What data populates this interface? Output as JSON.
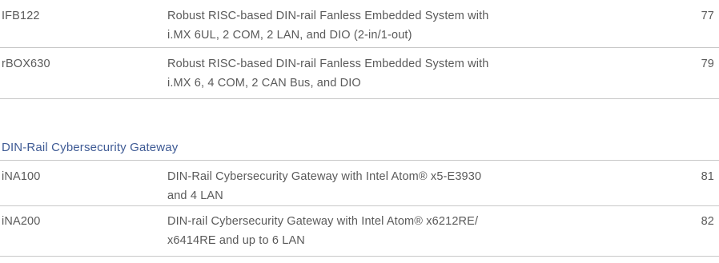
{
  "groups": [
    {
      "rows": [
        {
          "model": "IFB122",
          "desc_line1": "Robust RISC-based DIN-rail Fanless Embedded System with",
          "desc_line2": "i.MX 6UL, 2 COM, 2 LAN, and DIO (2-in/1-out)",
          "page": "77"
        },
        {
          "model": "rBOX630",
          "desc_line1": "Robust RISC-based DIN-rail Fanless Embedded System with",
          "desc_line2": "i.MX 6, 4 COM, 2 CAN Bus, and DIO",
          "page": "79"
        }
      ]
    },
    {
      "title": "DIN-Rail Cybersecurity Gateway",
      "rows": [
        {
          "model": "iNA100",
          "desc_line1": "DIN-Rail Cybersecurity Gateway with Intel Atom® x5-E3930",
          "desc_line2": "and 4 LAN",
          "page": "81"
        },
        {
          "model": "iNA200",
          "desc_line1": "DIN-rail Cybersecurity Gateway with Intel Atom® x6212RE/",
          "desc_line2": "x6414RE and up to 6 LAN",
          "page": "82"
        }
      ]
    }
  ],
  "colors": {
    "text": "#5a5a5a",
    "section_title": "#3f5b95",
    "rule": "#c8c8c8"
  }
}
